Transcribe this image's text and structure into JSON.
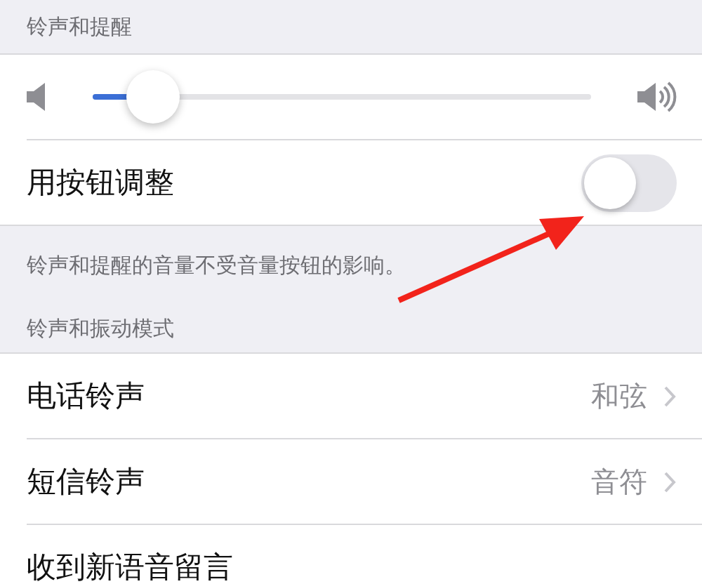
{
  "ringer_section": {
    "header": "铃声和提醒",
    "volume": {
      "level": 0.12
    },
    "toggle": {
      "label": "用按钮调整",
      "on": false
    },
    "footer": "铃声和提醒的音量不受音量按钮的影响。"
  },
  "pattern_section": {
    "header": "铃声和振动模式",
    "rows": [
      {
        "label": "电话铃声",
        "value": "和弦"
      },
      {
        "label": "短信铃声",
        "value": "音符"
      },
      {
        "label": "收到新语音留言"
      }
    ]
  }
}
